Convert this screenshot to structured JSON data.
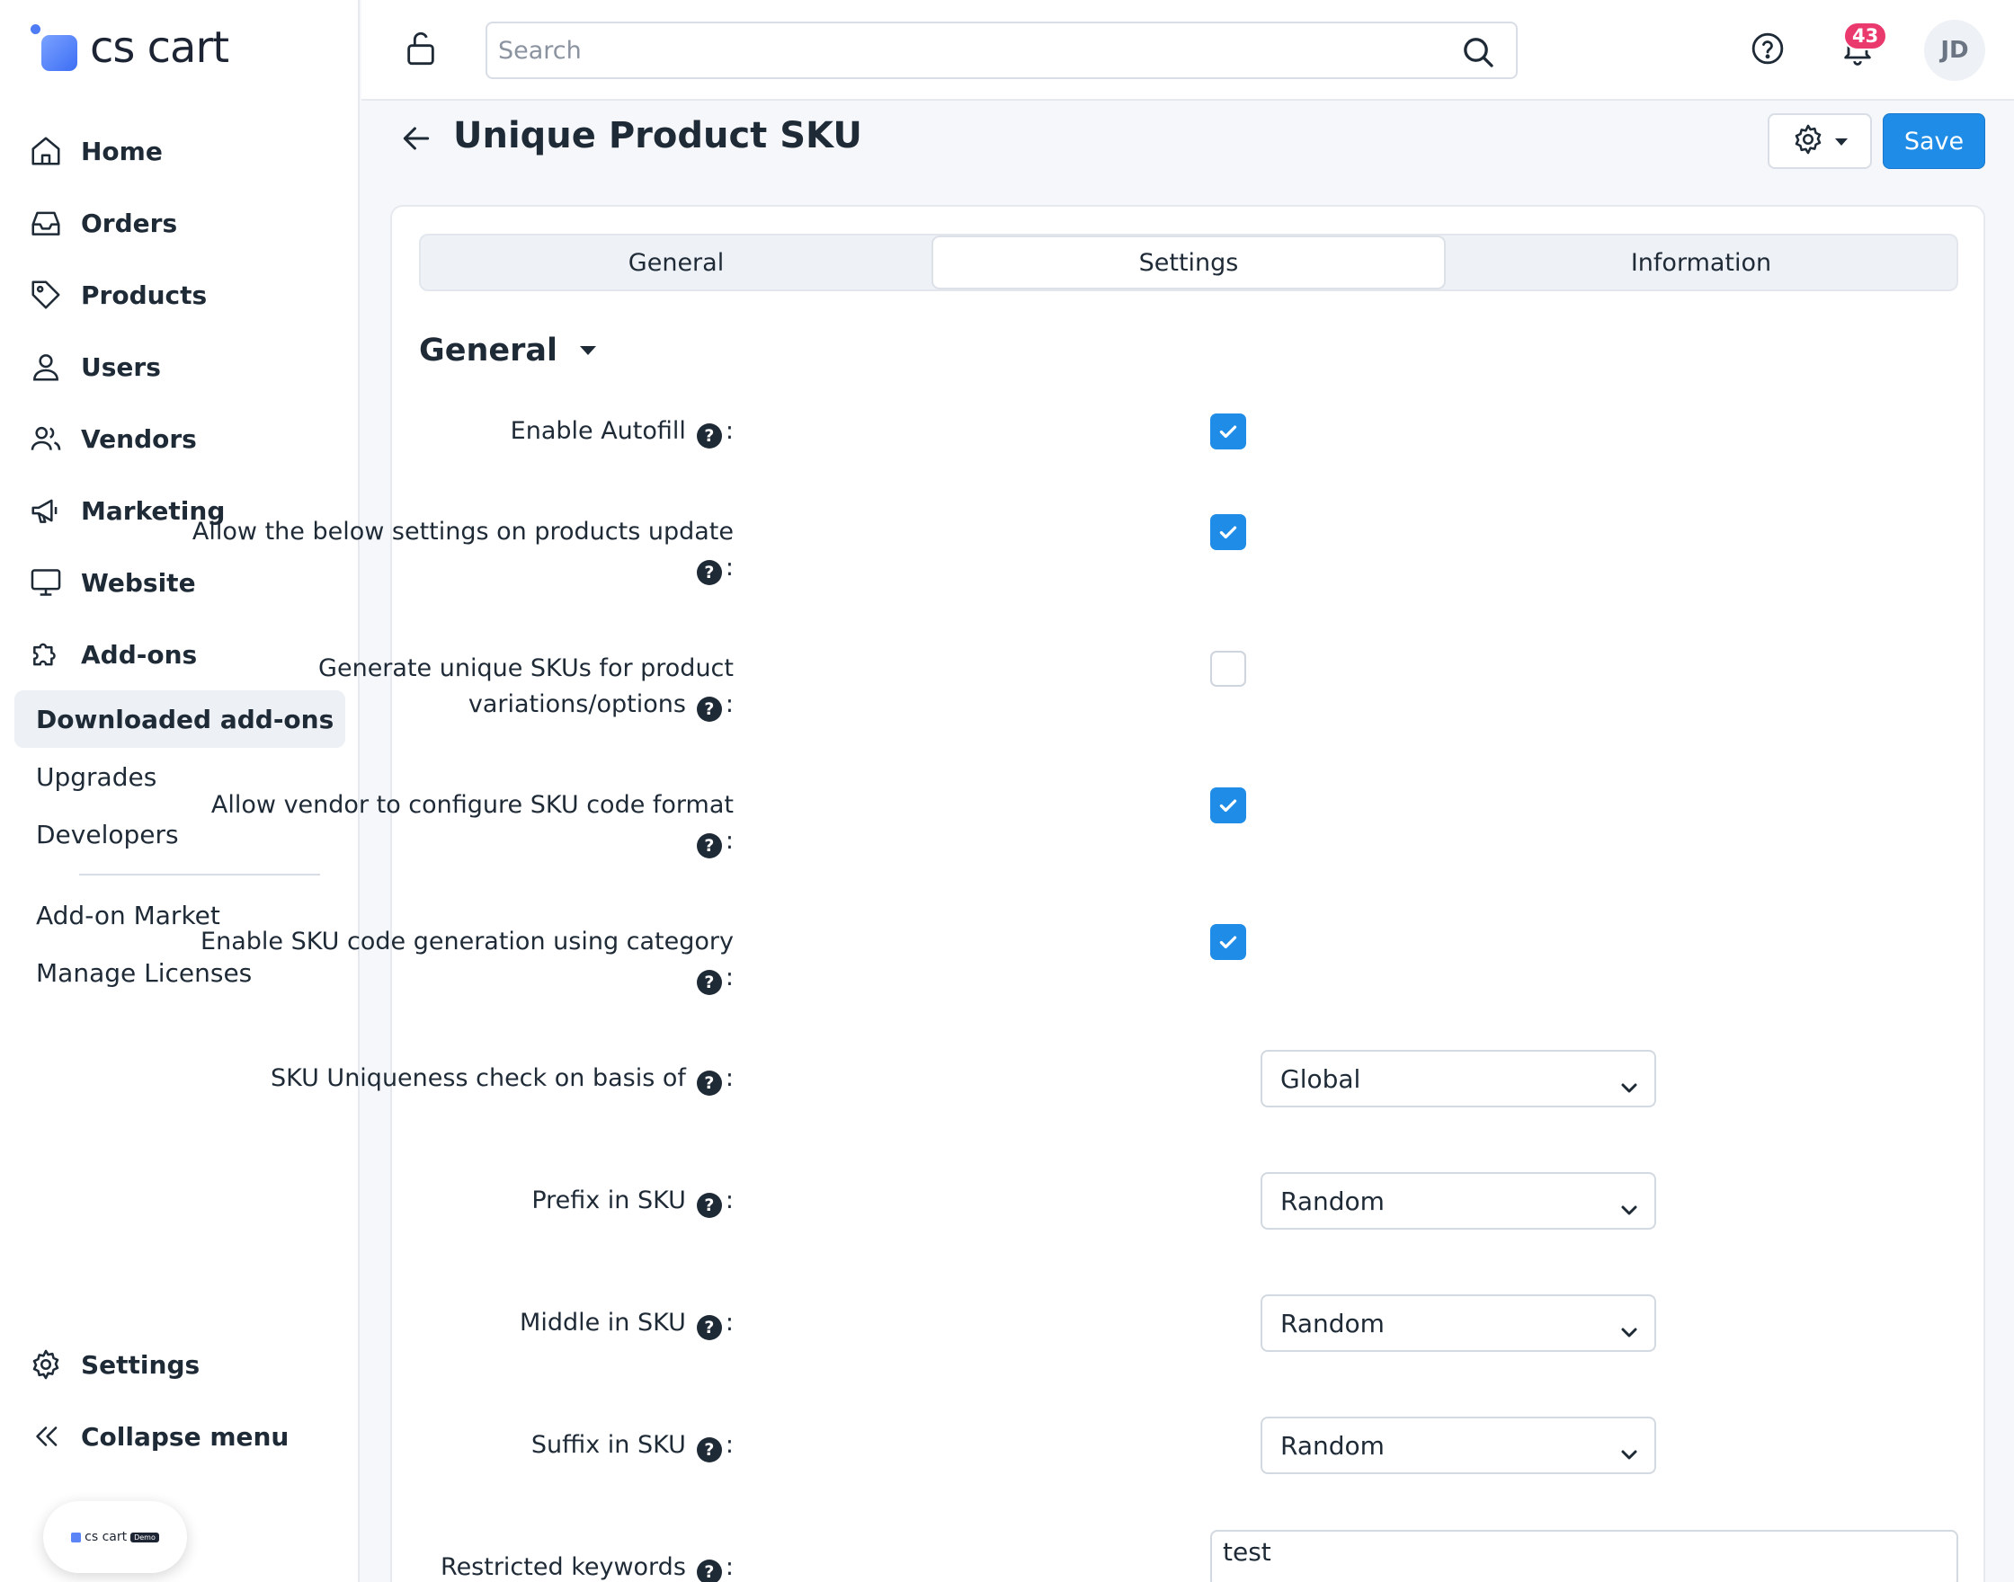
{
  "brand": {
    "logo_text": "cs cart",
    "demo_text": "cs cart",
    "demo_tag": "Demo"
  },
  "sidebar": {
    "items": [
      {
        "label": "Home",
        "icon": "home-icon"
      },
      {
        "label": "Orders",
        "icon": "inbox-icon"
      },
      {
        "label": "Products",
        "icon": "tag-icon"
      },
      {
        "label": "Users",
        "icon": "user-icon"
      },
      {
        "label": "Vendors",
        "icon": "users-icon"
      },
      {
        "label": "Marketing",
        "icon": "megaphone-icon"
      },
      {
        "label": "Website",
        "icon": "monitor-icon"
      },
      {
        "label": "Add-ons",
        "icon": "puzzle-icon"
      }
    ],
    "subitems": [
      "Downloaded add-ons",
      "Upgrades",
      "Developers"
    ],
    "subitems_extra": [
      "Add-on Market",
      "Manage Licenses"
    ],
    "bottom": [
      {
        "label": "Settings",
        "icon": "gear-icon"
      },
      {
        "label": "Collapse menu",
        "icon": "chevrons-left-icon"
      }
    ]
  },
  "header": {
    "search_placeholder": "Search",
    "notification_count": "43",
    "avatar_initials": "JD"
  },
  "page": {
    "title": "Unique Product SKU",
    "save_label": "Save"
  },
  "tabs": [
    "General",
    "Settings",
    "Information"
  ],
  "section": {
    "title": "General"
  },
  "settings": {
    "enable_autofill": {
      "label": "Enable Autofill",
      "checked": true
    },
    "allow_update": {
      "label_line1": "Allow the below settings on products update",
      "checked": true
    },
    "generate_unique": {
      "label_line1": "Generate unique SKUs for product",
      "label_line2": "variations/options",
      "checked": false
    },
    "allow_vendor": {
      "label_line1": "Allow vendor to configure SKU code format",
      "checked": true
    },
    "category_generation": {
      "label_line1": "Enable SKU code generation using category",
      "checked": true
    },
    "uniqueness": {
      "label": "SKU Uniqueness check on basis of",
      "value": "Global"
    },
    "prefix": {
      "label": "Prefix in SKU",
      "value": "Random"
    },
    "middle": {
      "label": "Middle in SKU",
      "value": "Random"
    },
    "suffix": {
      "label": "Suffix in SKU",
      "value": "Random"
    },
    "restricted": {
      "label": "Restricted keywords",
      "value": "test"
    }
  },
  "colors": {
    "accent": "#1f8de8",
    "badge": "#ea3a6d",
    "text": "#1f2a37"
  }
}
